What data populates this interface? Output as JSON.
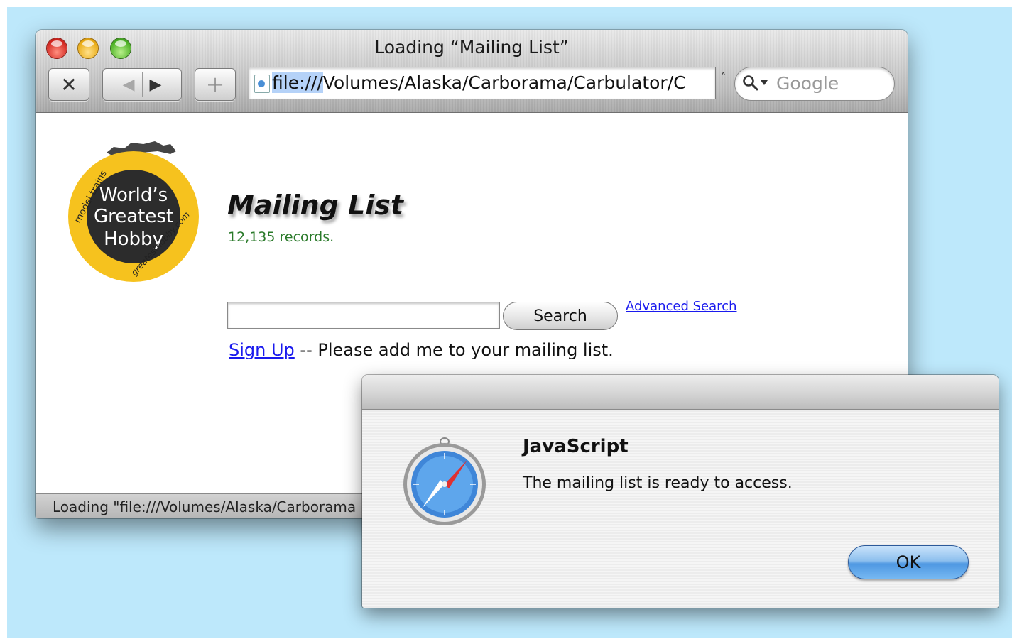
{
  "window": {
    "title": "Loading “Mailing List”"
  },
  "toolbar": {
    "stop_glyph": "✕",
    "back_glyph": "◀",
    "forward_glyph": "▶",
    "add_glyph": "+",
    "url_selected": "file:///",
    "url_rest": "Volumes/Alaska/Carborama/Carbulator/C",
    "url_caret": "˄",
    "search_placeholder": "Google"
  },
  "logo": {
    "top_text": "model trains",
    "line1": "World’s",
    "line2": "Greatest",
    "line3": "Hobby",
    "side_text": "greatesthobby.com"
  },
  "page": {
    "title": "Mailing List",
    "records": "12,135 records.",
    "search_button": "Search",
    "advanced_search": "Advanced Search",
    "signup_link": "Sign Up",
    "signup_text": " -- Please add me to your mailing list."
  },
  "status": {
    "text": "Loading \"file:///Volumes/Alaska/Carborama"
  },
  "dialog": {
    "heading": "JavaScript",
    "message": "The mailing list is ready to access.",
    "ok_label": "OK"
  },
  "colors": {
    "desktop": "#bde8fb",
    "logo_yellow": "#f6c21e",
    "link": "#1a1aee",
    "records_green": "#2a7a2a",
    "ok_blue": "#4f98e2"
  }
}
